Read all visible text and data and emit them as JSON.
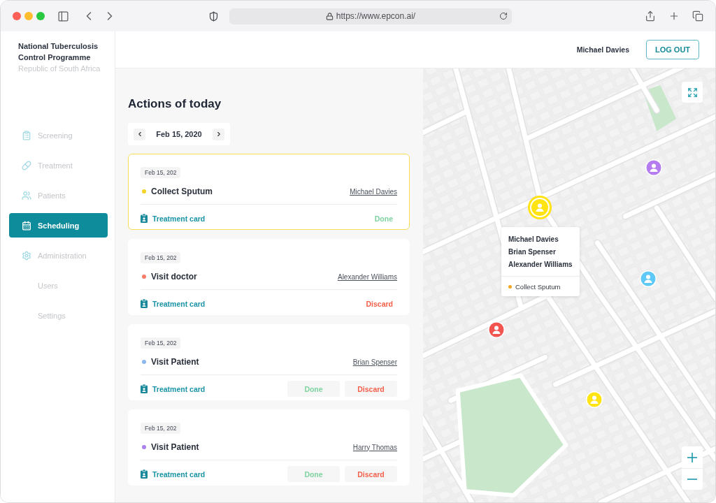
{
  "browser": {
    "url": "https://www.epcon.ai/"
  },
  "sidebar": {
    "org_name": "National Tuberculosis Control Programme",
    "country": "Republic of South Africa",
    "items": [
      {
        "label": "Screening",
        "selected": false
      },
      {
        "label": "Treatment",
        "selected": false
      },
      {
        "label": "Patients",
        "selected": false
      },
      {
        "label": "Scheduling",
        "selected": true
      },
      {
        "label": "Administration",
        "selected": false,
        "children": [
          {
            "label": "Users",
            "selected": false
          },
          {
            "label": "Settings",
            "selected": false
          }
        ]
      }
    ]
  },
  "header": {
    "user_name": "Michael Davies",
    "logout_label": "LOG OUT"
  },
  "actions_panel": {
    "title": "Actions of today",
    "date": "Feb 15, 2020",
    "actions": [
      {
        "date": "Feb 15, 202",
        "title": "Collect Sputum",
        "color": "#f5d327",
        "assignee": "Michael Davies",
        "selected": true,
        "link_label": "Treatment card",
        "buttons": [
          {
            "label": "Done",
            "kind": "done"
          }
        ]
      },
      {
        "date": "Feb 15, 202",
        "title": "Visit doctor",
        "color": "#f47c68",
        "assignee": "Alexander Williams",
        "selected": false,
        "link_label": "Treatment card",
        "buttons": [
          {
            "label": "Discard",
            "kind": "discard"
          }
        ]
      },
      {
        "date": "Feb 15, 202",
        "title": "Visit Patient",
        "color": "#8cb8ee",
        "assignee": "Brian Spenser",
        "selected": false,
        "link_label": "Treatment card",
        "buttons": [
          {
            "label": "Done",
            "kind": "done"
          },
          {
            "label": "Discard",
            "kind": "discard"
          }
        ]
      },
      {
        "date": "Feb 15, 202",
        "title": "Visit Patient",
        "color": "#ab80f0",
        "assignee": "Harry Thomas",
        "selected": false,
        "link_label": "Treatment card",
        "buttons": [
          {
            "label": "Done",
            "kind": "done"
          },
          {
            "label": "Discard",
            "kind": "discard"
          }
        ]
      }
    ]
  },
  "map": {
    "markers": [
      {
        "color": "#ffe312",
        "selected": true
      },
      {
        "color": "#b57cef",
        "selected": false
      },
      {
        "color": "#5ec9f6",
        "selected": false
      },
      {
        "color": "#f2544f",
        "selected": false
      },
      {
        "color": "#ffe312",
        "selected": false
      }
    ],
    "popup": {
      "names": [
        "Michael Davies",
        "Brian Spenser",
        "Alexander Williams"
      ],
      "action": {
        "label": "Collect Sputum",
        "color": "#f5a623"
      }
    }
  }
}
